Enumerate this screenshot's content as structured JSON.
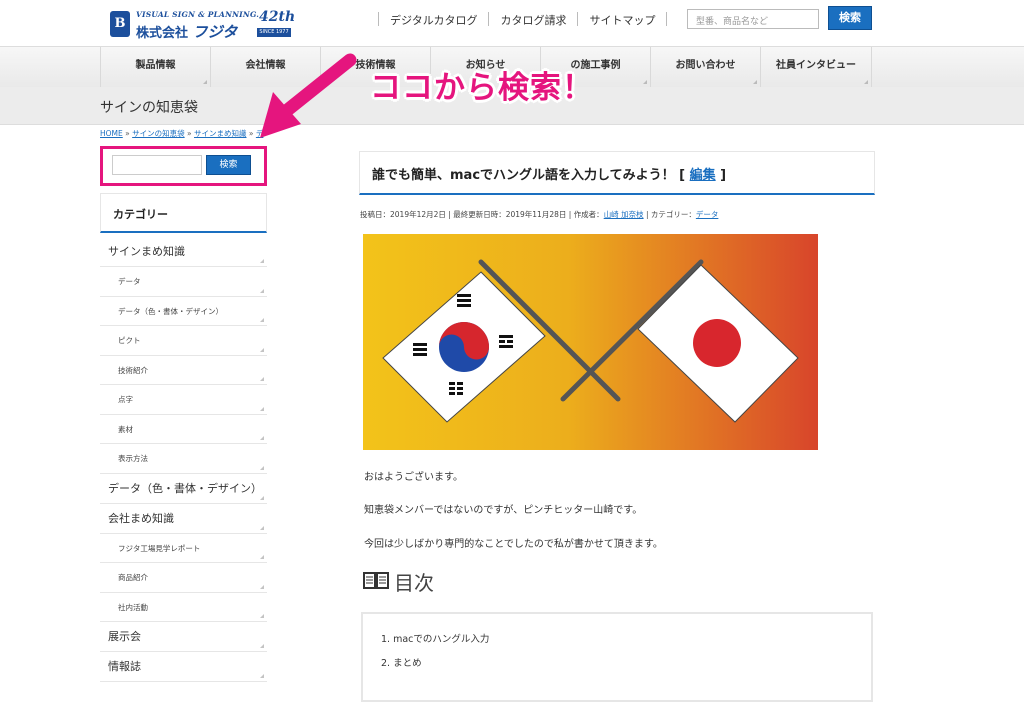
{
  "header": {
    "logo_tagline": "VISUAL SIGN & PLANNING.",
    "logo_company_prefix": "株式会社",
    "logo_company_name": "フジタ",
    "anniversary_number": "42th",
    "anniversary_since": "SINCE 1977",
    "top_links": [
      "デジタルカタログ",
      "カタログ請求",
      "サイトマップ"
    ],
    "search_placeholder": "型番、商品名など",
    "search_button": "検索"
  },
  "nav": {
    "items": [
      "製品情報",
      "会社情報",
      "技術情報",
      "お知らせ",
      "の施工事例",
      "お問い合わせ",
      "社員インタビュー"
    ]
  },
  "page_title": "サインの知恵袋",
  "annotation": {
    "text": "ココから検索！",
    "color": "#e5157e"
  },
  "breadcrumb": {
    "items": [
      "HOME",
      "サインの知恵袋",
      "サインまめ知識",
      "デ"
    ],
    "separator": "»"
  },
  "sidebar": {
    "search_button": "検索",
    "category_heading": "カテゴリー",
    "categories": [
      {
        "label": "サインまめ知識",
        "level": 1
      },
      {
        "label": "データ",
        "level": 2
      },
      {
        "label": "データ（色・書体・デザイン）",
        "level": 2
      },
      {
        "label": "ピクト",
        "level": 2
      },
      {
        "label": "技術紹介",
        "level": 2
      },
      {
        "label": "点字",
        "level": 2
      },
      {
        "label": "素材",
        "level": 2
      },
      {
        "label": "表示方法",
        "level": 2
      },
      {
        "label": "データ（色・書体・デザイン）",
        "level": 1
      },
      {
        "label": "会社まめ知識",
        "level": 1
      },
      {
        "label": "フジタ工場見学レポート",
        "level": 2
      },
      {
        "label": "商品紹介",
        "level": 2
      },
      {
        "label": "社内活動",
        "level": 2
      },
      {
        "label": "展示会",
        "level": 1
      },
      {
        "label": "情報誌",
        "level": 1
      }
    ]
  },
  "article": {
    "title": "誰でも簡単、macでハングル語を入力してみよう！",
    "edit_label": "編集",
    "meta": {
      "posted_label": "投稿日：",
      "posted_date": "2019年12月2日",
      "updated_label": "最終更新日時：",
      "updated_date": "2019年11月28日",
      "author_label": "作成者：",
      "author": "山崎 加奈枝",
      "category_label": "カテゴリー：",
      "category": "データ"
    },
    "paragraphs": [
      "おはようございます。",
      "知恵袋メンバーではないのですが、ピンチヒッター山崎です。",
      "今回は少しばかり専門的なことでしたので私が書かせて頂きます。"
    ],
    "toc_title": "目次",
    "toc_items": [
      "1. macでのハングル入力",
      "2. まとめ"
    ]
  },
  "colors": {
    "accent_blue": "#1a6fc0",
    "highlight_pink": "#e5157e"
  }
}
